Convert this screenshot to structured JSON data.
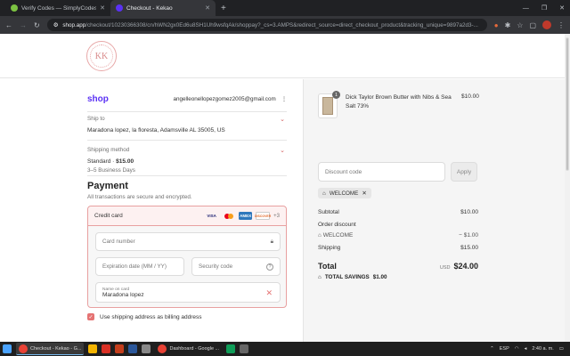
{
  "browser": {
    "tabs": [
      {
        "title": "Verify Codes — SimplyCodes",
        "color": "#7cc242"
      },
      {
        "title": "Checkout - Kekao",
        "color": "#5a31f4"
      }
    ],
    "new_tab": "+",
    "url_host": "shop.app",
    "url_path": "/checkout/10230366308/cn/hWN2gx0Ed6u8SH1Uh9wsfqAk/shoppay?_cs=3.AMPS&redirect_source=direct_checkout_product&tracking_unique=9897a2d3-..."
  },
  "store": {
    "logo_text": "KK"
  },
  "shop_pay": {
    "brand": "shop",
    "email": "angelleonellopezgomez2005@gmail.com"
  },
  "ship_to": {
    "label": "Ship to",
    "value": "Maradona lopez, la floresta, Adamsville AL 35005, US"
  },
  "shipping_method": {
    "label": "Shipping method",
    "value": "Standard · ",
    "price": "$15.00",
    "eta": "3–5 Business Days"
  },
  "payment": {
    "title": "Payment",
    "subtitle": "All transactions are secure and encrypted.",
    "method": "Credit card",
    "brands": [
      "VISA",
      "MC",
      "AMEX",
      "DISCOVER"
    ],
    "more_brands": "+3",
    "card_number_placeholder": "Card number",
    "expiry_placeholder": "Expiration date (MM / YY)",
    "cvc_placeholder": "Security code",
    "name_label": "Name on card",
    "name_value": "Maradona lopez",
    "billing_same": "Use shipping address as billing address"
  },
  "order": {
    "item": {
      "name": "Dick Taylor Brown Butter with Nibs & Sea Salt 73%",
      "qty": "1",
      "price": "$10.00"
    },
    "discount_placeholder": "Discount code",
    "apply_label": "Apply",
    "applied_code": "WELCOME",
    "subtotal_label": "Subtotal",
    "subtotal": "$10.00",
    "order_discount_label": "Order discount",
    "discount_code": "WELCOME",
    "discount_amount": "− $1.00",
    "shipping_label": "Shipping",
    "shipping": "$15.00",
    "total_label": "Total",
    "currency": "USD",
    "total": "$24.00",
    "savings_label": "TOTAL SAVINGS",
    "savings": "$1.00"
  },
  "taskbar": {
    "apps": [
      {
        "title": "Checkout - Kekao - G...",
        "active": true
      },
      {
        "title": "Dashboard - Google ...",
        "active": false
      }
    ],
    "lang": "ESP",
    "time": "2:40 a. m."
  }
}
